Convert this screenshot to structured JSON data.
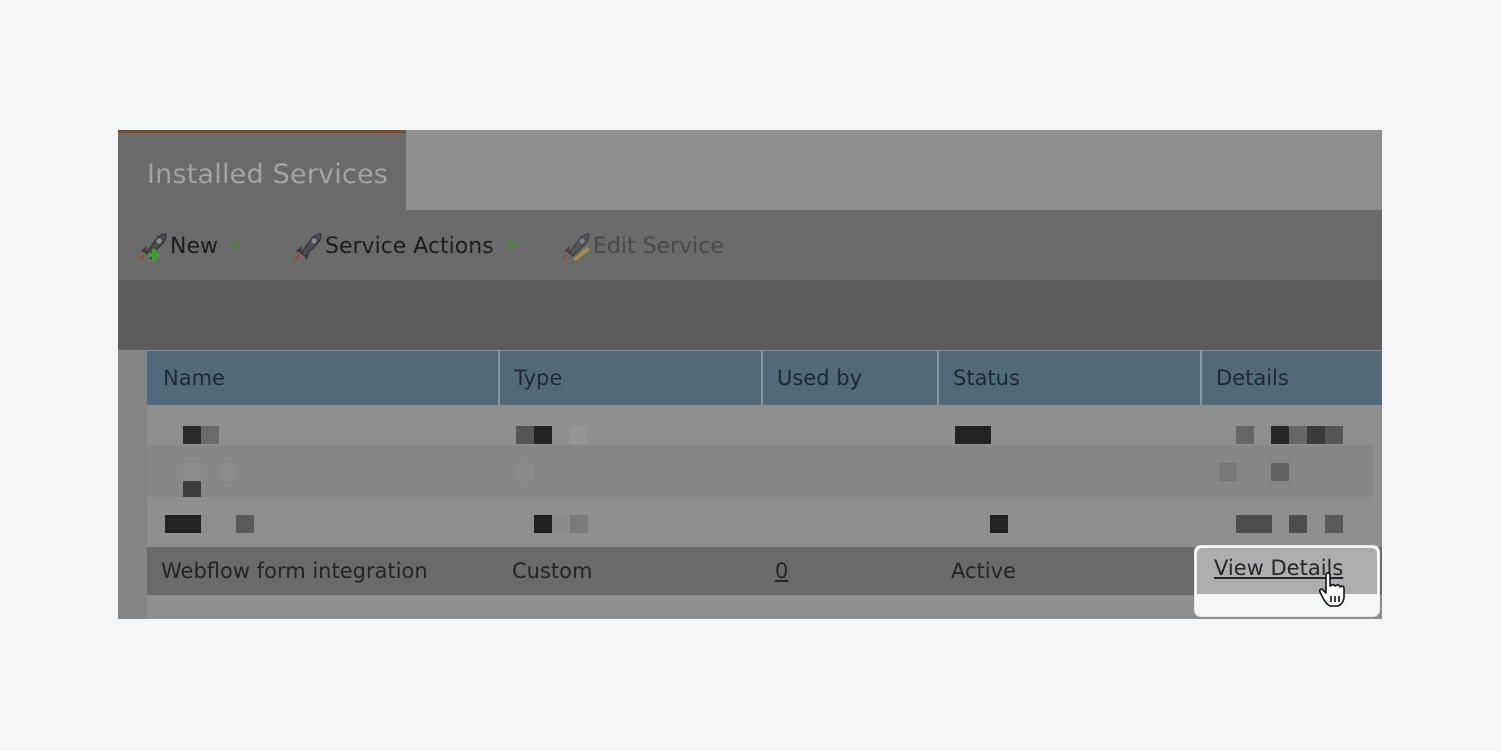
{
  "tab": {
    "label": "Installed Services",
    "accent_color": "#7c4a2a"
  },
  "toolbar": {
    "new_label": "New",
    "service_actions_label": "Service Actions",
    "edit_service_label": "Edit Service"
  },
  "table": {
    "header_color": "#506a7a",
    "columns": [
      "Name",
      "Type",
      "Used by",
      "Status",
      "Details"
    ],
    "redacted_rows": 3,
    "visible_row": {
      "name": "Webflow form integration",
      "type": "Custom",
      "used_by": "0",
      "status": "Active",
      "details": "View Details"
    }
  }
}
